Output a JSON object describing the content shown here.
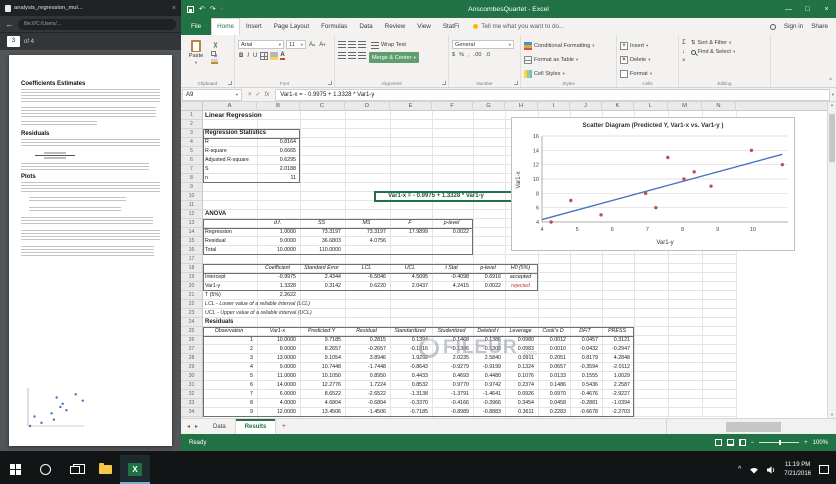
{
  "icons": {
    "dd": "▾",
    "close": "×",
    "back": "←",
    "undo": "↶",
    "redo": "↷",
    "minimize": "—",
    "maximize": "□",
    "caret_up": "^",
    "check": "✓",
    "cancel": "×",
    "fx": "fx",
    "sigma": "Σ",
    "fill_down": "↓",
    "clear_x": "×",
    "sort": "⇅",
    "tab_prev": "◂",
    "tab_next": "▸",
    "add": "+",
    "scroll_up": "▴",
    "scroll_down": "▾",
    "bold": "B",
    "italic": "I",
    "underline": "U",
    "dollar": "$",
    "percent": "%",
    "comma": ",",
    "dec_inc": ".00",
    "dec_dec": ".0",
    "minus": "−",
    "plus": "+"
  },
  "pdf_viewer": {
    "tab_title": "analysis_regression_mul...",
    "url": "file:///C:/Users/...",
    "page_current": "3",
    "page_of": "of 4",
    "heading_coefficients": "Coefficients Estimates",
    "heading_residuals": "Residuals",
    "heading_plots": "Plots"
  },
  "excel": {
    "title": "AnscombesQuartet - Excel",
    "ribbon": {
      "file_tab": "File",
      "tabs": [
        "Home",
        "Insert",
        "Page Layout",
        "Formulas",
        "Data",
        "Review",
        "View",
        "StatFi"
      ],
      "tell_me": "Tell me what you want to do...",
      "sign_in": "Sign in",
      "share": "Share",
      "paste": "Paste",
      "font_name": "Arial",
      "font_size": "11",
      "wrap_text": "Wrap Text",
      "merge_center": "Merge & Center",
      "number_format": "General",
      "conditional_formatting": "Conditional Formatting",
      "format_as_table": "Format as Table",
      "cell_styles": "Cell Styles",
      "insert": "Insert",
      "delete": "Delete",
      "format": "Format",
      "sort_filter": "Sort & Filter",
      "find_select": "Find & Select",
      "groups": [
        "Clipboard",
        "Font",
        "Alignment",
        "Number",
        "Styles",
        "Cells",
        "Editing"
      ]
    },
    "formula_bar": {
      "name_box": "A9",
      "formula": "Var1-x = - 0.9975 + 1.3328 * Var1-y"
    },
    "columns": [
      "A",
      "B",
      "C",
      "D",
      "E",
      "F",
      "G",
      "H",
      "I",
      "J",
      "K",
      "L",
      "M",
      "N"
    ],
    "rows_visible": 34,
    "sheet": {
      "title": "Linear Regression",
      "reg_stats": {
        "header": "Regression Statistics",
        "rows": [
          [
            "R",
            "0.8164"
          ],
          [
            "R-square",
            "0.6665"
          ],
          [
            "Adjusted R-square",
            "0.6295"
          ],
          [
            "S",
            "2.0188"
          ],
          [
            "n",
            "11"
          ]
        ]
      },
      "equation": "Var1-x = - 0.9975 + 1.3328 * Var1-y",
      "anova": {
        "header": "ANOVA",
        "col_headers": [
          "",
          "d.f.",
          "SS",
          "MS",
          "F",
          "p-level"
        ],
        "rows": [
          [
            "Regression",
            "1.0000",
            "73.3197",
            "73.3197",
            "17.9899",
            "0.0022"
          ],
          [
            "Residual",
            "9.0000",
            "36.6803",
            "4.0756",
            "",
            ""
          ],
          [
            "Total",
            "10.0000",
            "110.0000",
            "",
            "",
            ""
          ]
        ]
      },
      "coeffs": {
        "col_headers": [
          "",
          "Coefficient",
          "Standard Error",
          "LCL",
          "UCL",
          "t Stat",
          "p-level",
          "H0 (5%)"
        ],
        "rows": [
          [
            "Intercept",
            "-0.9975",
            "2.4344",
            "-6.5046",
            "4.5095",
            "-0.4098",
            "0.6916",
            "accepted"
          ],
          [
            "Var1-y",
            "1.3328",
            "0.3142",
            "0.6220",
            "2.0437",
            "4.2415",
            "0.0022",
            "rejected"
          ],
          [
            "T (5%)",
            "2.2622",
            "",
            "",
            "",
            "",
            "",
            ""
          ]
        ],
        "note_lcl": "LCL - Lower value of a reliable interval (LCL)",
        "note_ucl": "UCL - Upper value of a reliable interval (UCL)"
      },
      "residuals": {
        "header": "Residuals",
        "col_headers": [
          "Observation",
          "Var1-x",
          "Predicted Y",
          "Residual",
          "Standardized",
          "Studentized",
          "Deleted t",
          "Leverage",
          "Cook's D",
          "DFiT",
          "PRESS"
        ],
        "rows": [
          [
            "1",
            "10.0000",
            "9.7185",
            "0.2815",
            "0.1394",
            "0.1468",
            "0.1386",
            "0.0980",
            "0.0012",
            "0.0457",
            "0.3121"
          ],
          [
            "2",
            "8.0000",
            "8.2657",
            "-0.2657",
            "-0.1316",
            "-0.1386",
            "-0.1308",
            "0.0983",
            "0.0010",
            "-0.0432",
            "-0.2947"
          ],
          [
            "3",
            "13.0000",
            "9.1054",
            "3.8946",
            "1.9292",
            "2.0235",
            "2.5840",
            "0.0911",
            "0.2051",
            "0.8179",
            "4.2848"
          ],
          [
            "4",
            "9.0000",
            "10.7448",
            "-1.7448",
            "-0.8643",
            "-0.9279",
            "-0.9199",
            "0.1324",
            "0.0657",
            "-0.3594",
            "-2.0112"
          ],
          [
            "5",
            "11.0000",
            "10.1050",
            "0.8950",
            "0.4433",
            "0.4693",
            "0.4480",
            "0.1076",
            "0.0133",
            "0.1555",
            "1.0029"
          ],
          [
            "6",
            "14.0000",
            "12.2776",
            "1.7224",
            "0.8532",
            "0.9770",
            "0.9742",
            "0.2374",
            "0.1486",
            "0.5436",
            "2.2587"
          ],
          [
            "7",
            "6.0000",
            "8.6522",
            "-2.6522",
            "-1.3138",
            "-1.3791",
            "-1.4641",
            "0.0926",
            "0.0970",
            "-0.4676",
            "-2.9227"
          ],
          [
            "8",
            "4.0000",
            "4.6804",
            "-0.6804",
            "-0.3370",
            "-0.4166",
            "-0.3966",
            "0.3454",
            "0.0458",
            "-0.2881",
            "-1.0394"
          ],
          [
            "9",
            "12.0000",
            "13.4506",
            "-1.4506",
            "-0.7185",
            "-0.8989",
            "-0.8883",
            "0.3611",
            "0.2283",
            "-0.6678",
            "-2.2703"
          ]
        ]
      }
    },
    "sheet_tabs": [
      "Data",
      "Results"
    ],
    "active_sheet": "Results",
    "status": "Ready",
    "zoom": "100%"
  },
  "chart_data": {
    "type": "scatter",
    "title": "Scatter Diagram (Predicted Y, Var1-x vs. Var1-y )",
    "xlabel": "Var1-y",
    "ylabel": "Var1-x",
    "xlim": [
      4,
      11
    ],
    "ylim": [
      4,
      16
    ],
    "x_ticks": [
      4,
      5,
      6,
      7,
      8,
      9,
      10
    ],
    "y_ticks": [
      4,
      6,
      8,
      10,
      12,
      14,
      16
    ],
    "grid": true,
    "legend": false,
    "series": [
      {
        "name": "Data points",
        "type": "scatter",
        "color": "#c0504d",
        "points": [
          [
            8.04,
            10
          ],
          [
            6.95,
            8
          ],
          [
            7.58,
            13
          ],
          [
            8.81,
            9
          ],
          [
            8.33,
            11
          ],
          [
            9.96,
            14
          ],
          [
            7.24,
            6
          ],
          [
            4.26,
            4
          ],
          [
            10.84,
            12
          ],
          [
            4.82,
            7
          ],
          [
            5.68,
            5
          ]
        ]
      },
      {
        "name": "Trend line",
        "type": "line",
        "color": "#4472c4",
        "points": [
          [
            4,
            4.3337
          ],
          [
            10.84,
            13.4501
          ]
        ]
      }
    ]
  },
  "watermark": {
    "text": "FILEUR",
    "suffix": ".com"
  },
  "taskbar": {
    "time": "11:19 PM",
    "date": "7/21/2016"
  }
}
